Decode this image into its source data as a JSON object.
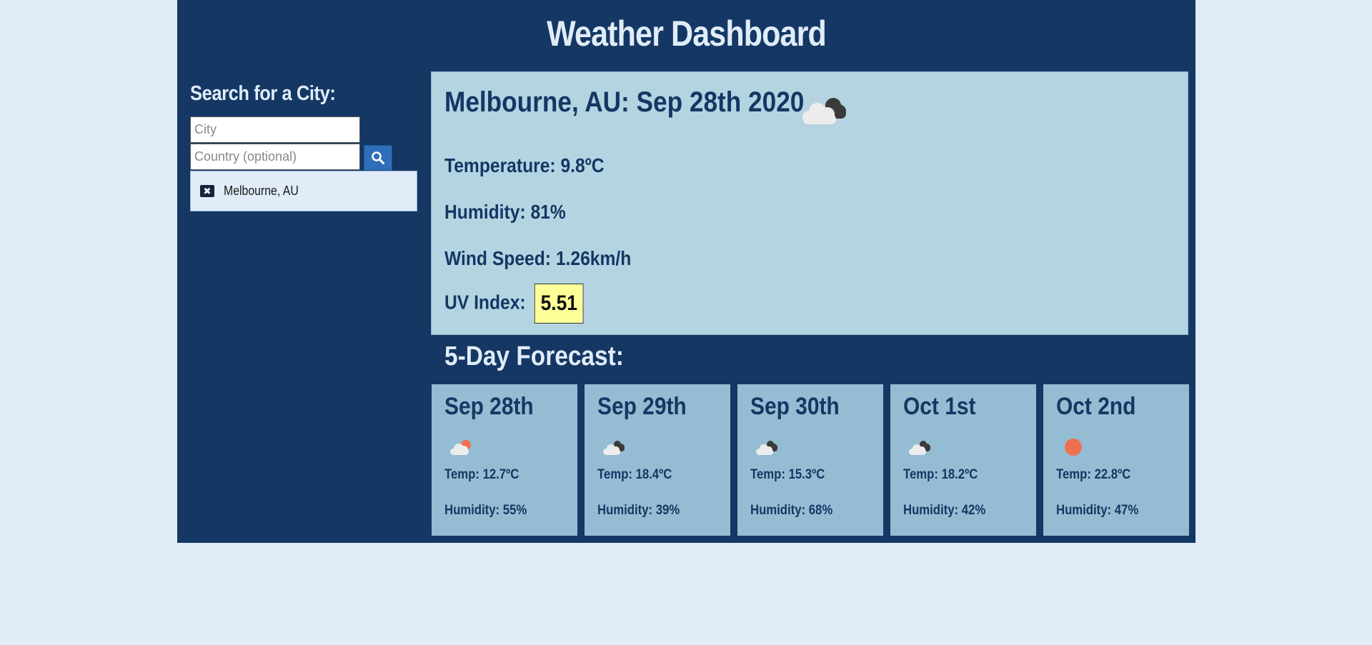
{
  "header": {
    "title": "Weather Dashboard"
  },
  "sidebar": {
    "heading": "Search for a City:",
    "city_placeholder": "City",
    "country_placeholder": "Country (optional)",
    "history": [
      {
        "label": "Melbourne, AU"
      }
    ]
  },
  "current": {
    "title": "Melbourne, AU: Sep 28th 2020",
    "icon": "broken-clouds-icon",
    "temperature": "Temperature: 9.8ºC",
    "humidity": "Humidity: 81%",
    "wind": "Wind Speed: 1.26km/h",
    "uv_label": "UV Index:",
    "uv_value": "5.51",
    "uv_color": "#ffff99"
  },
  "forecast": {
    "heading": "5-Day Forecast:",
    "days": [
      {
        "date": "Sep 28th",
        "icon": "partly-cloudy-icon",
        "temp": "Temp: 12.7ºC",
        "humidity": "Humidity: 55%"
      },
      {
        "date": "Sep 29th",
        "icon": "broken-clouds-icon",
        "temp": "Temp: 18.4ºC",
        "humidity": "Humidity: 39%"
      },
      {
        "date": "Sep 30th",
        "icon": "broken-clouds-icon",
        "temp": "Temp: 15.3ºC",
        "humidity": "Humidity: 68%"
      },
      {
        "date": "Oct 1st",
        "icon": "broken-clouds-icon",
        "temp": "Temp: 18.2ºC",
        "humidity": "Humidity: 42%"
      },
      {
        "date": "Oct 2nd",
        "icon": "clear-sky-icon",
        "temp": "Temp: 22.8ºC",
        "humidity": "Humidity: 47%"
      }
    ]
  },
  "colors": {
    "page_bg": "#e0ecf8",
    "panel_bg": "#143764",
    "current_bg": "#b5d4e2",
    "card_bg": "#94bdd3",
    "accent_button": "#2f6fb9",
    "sun": "#ee7050"
  }
}
